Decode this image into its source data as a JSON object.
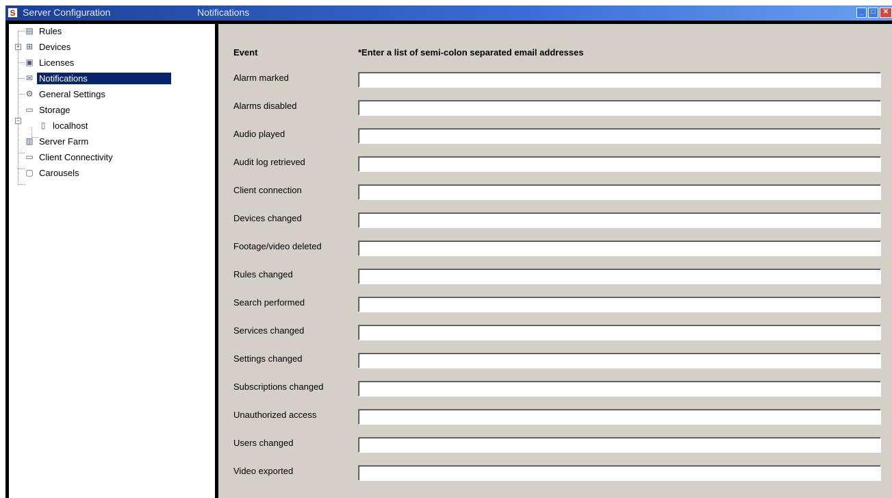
{
  "window": {
    "app_title": "Server Configuration",
    "pane_title": "Notifications",
    "logo_letter": "S"
  },
  "tree": {
    "items": [
      {
        "label": "Rules",
        "icon": "rules-icon"
      },
      {
        "label": "Devices",
        "icon": "devices-icon"
      },
      {
        "label": "Licenses",
        "icon": "licenses-icon"
      },
      {
        "label": "Notifications",
        "icon": "envelope-icon",
        "selected": true
      },
      {
        "label": "General Settings",
        "icon": "settings-icon"
      },
      {
        "label": "Storage",
        "icon": "storage-icon"
      },
      {
        "label": "localhost",
        "icon": "server-icon"
      },
      {
        "label": "Server Farm",
        "icon": "server-farm-icon"
      },
      {
        "label": "Client Connectivity",
        "icon": "client-connectivity-icon"
      },
      {
        "label": "Carousels",
        "icon": "carousels-icon"
      }
    ]
  },
  "notifications": {
    "event_header": "Event",
    "email_header": "*Enter a list of semi-colon separated email addresses",
    "events": [
      {
        "label": "Alarm marked",
        "value": ""
      },
      {
        "label": "Alarms disabled",
        "value": ""
      },
      {
        "label": "Audio played",
        "value": ""
      },
      {
        "label": "Audit log retrieved",
        "value": ""
      },
      {
        "label": "Client connection",
        "value": ""
      },
      {
        "label": "Devices changed",
        "value": ""
      },
      {
        "label": "Footage/video deleted",
        "value": ""
      },
      {
        "label": "Rules changed",
        "value": ""
      },
      {
        "label": "Search performed",
        "value": ""
      },
      {
        "label": "Services changed",
        "value": ""
      },
      {
        "label": "Settings changed",
        "value": ""
      },
      {
        "label": "Subscriptions changed",
        "value": ""
      },
      {
        "label": "Unauthorized access",
        "value": ""
      },
      {
        "label": "Users changed",
        "value": ""
      },
      {
        "label": "Video exported",
        "value": ""
      }
    ]
  },
  "colors": {
    "titlebar": "#1c3f95",
    "selection": "#0a246a",
    "panel_bg": "#d4d0c8"
  }
}
